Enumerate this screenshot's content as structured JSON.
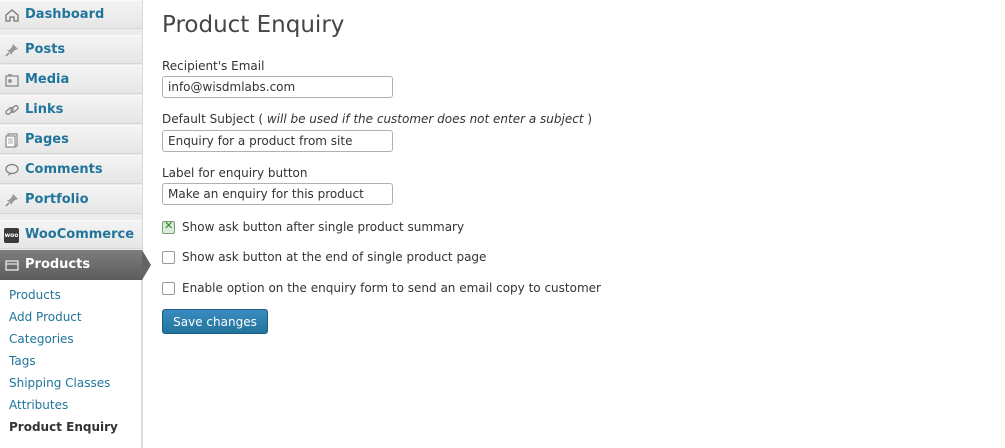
{
  "sidebar": {
    "menu": [
      {
        "label": "Dashboard",
        "icon": "dashboard-icon"
      },
      {
        "label": "Posts",
        "icon": "pushpin-icon"
      },
      {
        "label": "Media",
        "icon": "media-icon"
      },
      {
        "label": "Links",
        "icon": "link-icon"
      },
      {
        "label": "Pages",
        "icon": "pages-icon"
      },
      {
        "label": "Comments",
        "icon": "comment-icon"
      },
      {
        "label": "Portfolio",
        "icon": "pushpin-icon"
      },
      {
        "label": "WooCommerce",
        "icon": "woocommerce-icon",
        "badge": "woo"
      },
      {
        "label": "Products",
        "icon": "products-icon",
        "active": true
      }
    ],
    "submenu": [
      {
        "label": "Products"
      },
      {
        "label": "Add Product"
      },
      {
        "label": "Categories"
      },
      {
        "label": "Tags"
      },
      {
        "label": "Shipping Classes"
      },
      {
        "label": "Attributes"
      },
      {
        "label": "Product Enquiry",
        "current": true
      }
    ]
  },
  "main": {
    "title": "Product Enquiry",
    "fields": {
      "recipient_email": {
        "label": "Recipient's Email",
        "value": "info@wisdmlabs.com"
      },
      "default_subject": {
        "label": "Default Subject ( ",
        "hint": "will be used if the customer does not enter a subject",
        "label_end": " )",
        "value": "Enquiry for a product from site"
      },
      "button_label": {
        "label": "Label for enquiry button",
        "value": "Make an enquiry for this product"
      }
    },
    "options": [
      {
        "label": "Show ask button after single product summary",
        "checked": true
      },
      {
        "label": "Show ask button at the end of single product page",
        "checked": false
      },
      {
        "label": "Enable option on the enquiry form to send an email copy to customer",
        "checked": false
      }
    ],
    "save_label": "Save changes"
  },
  "colors": {
    "link": "#21759b",
    "sidebar_bg": "#ececec",
    "active_menu_bg": "#646464",
    "button_bg": "#21759b"
  }
}
